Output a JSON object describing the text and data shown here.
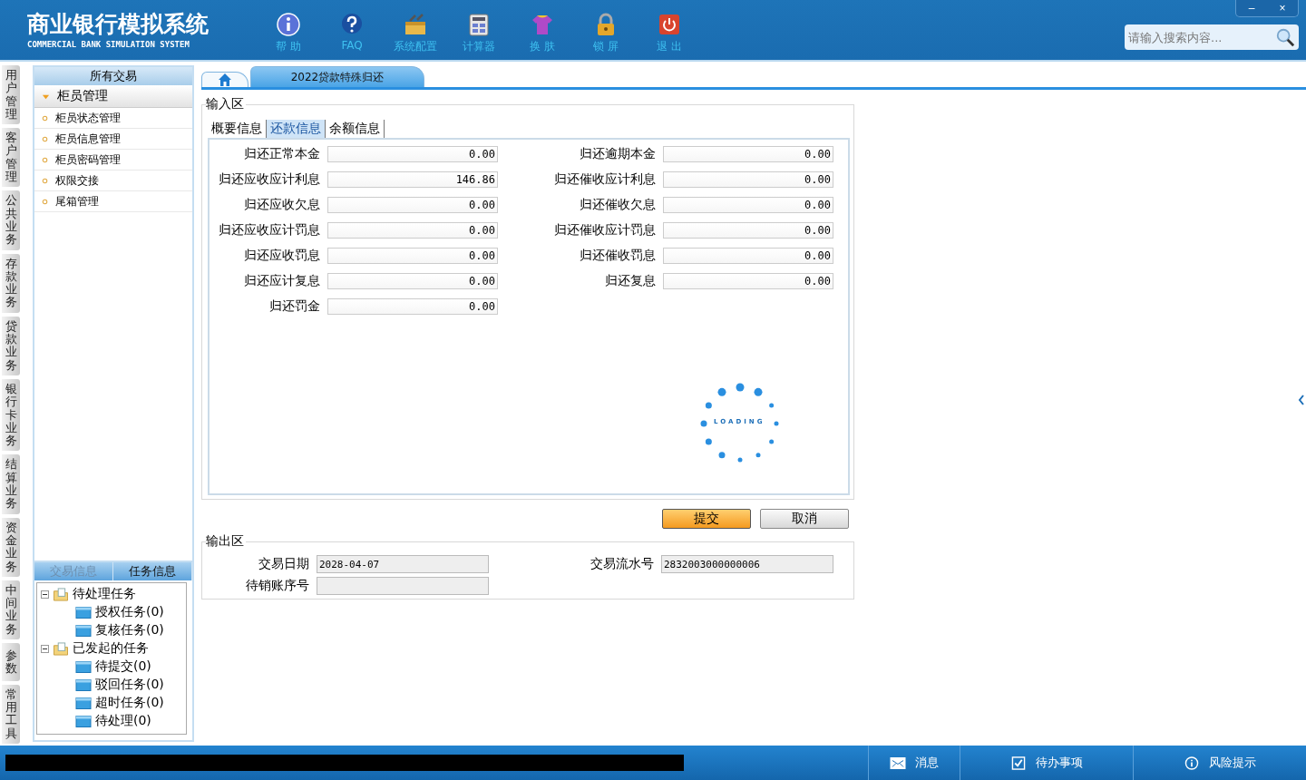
{
  "header": {
    "title": "商业银行模拟系统",
    "subtitle": "COMMERCIAL BANK SIMULATION SYSTEM",
    "tools": [
      {
        "kind": "info",
        "label": "帮 助"
      },
      {
        "kind": "faq",
        "label": "FAQ"
      },
      {
        "kind": "toolbox",
        "label": "系统配置"
      },
      {
        "kind": "calc",
        "label": "计算器"
      },
      {
        "kind": "shirt",
        "label": "换 肤"
      },
      {
        "kind": "lock",
        "label": "锁 屏"
      },
      {
        "kind": "power",
        "label": "退 出"
      }
    ],
    "window_buttons": [
      "–",
      "×"
    ],
    "search": {
      "placeholder": "请输入搜索内容..."
    }
  },
  "side_tabs": [
    "用户管理",
    "客户管理",
    "公共业务",
    "存款业务",
    "贷款业务",
    "银行卡业务",
    "结算业务",
    "资金业务",
    "中间业务",
    "参数",
    "常用工具"
  ],
  "sidebar": {
    "title": "所有交易",
    "group": {
      "label": "柜员管理",
      "expanded": true
    },
    "items": [
      "柜员状态管理",
      "柜员信息管理",
      "柜员密码管理",
      "权限交接",
      "尾箱管理"
    ]
  },
  "task_panel": {
    "tabs": [
      {
        "label": "交易信息",
        "selected": false
      },
      {
        "label": "任务信息",
        "selected": true
      }
    ],
    "tree": [
      {
        "label": "待处理任务",
        "expanded": true,
        "children": [
          {
            "label": "授权任务(0)"
          },
          {
            "label": "复核任务(0)"
          }
        ]
      },
      {
        "label": "已发起的任务",
        "expanded": true,
        "children": [
          {
            "label": "待提交(0)"
          },
          {
            "label": "驳回任务(0)"
          },
          {
            "label": "超时任务(0)"
          },
          {
            "label": "待处理(0)"
          }
        ]
      }
    ]
  },
  "page_tabs": [
    {
      "kind": "home",
      "selected": false
    },
    {
      "kind": "text",
      "label": "2022贷款特殊归还",
      "selected": true
    }
  ],
  "input_area": {
    "title": "输入区",
    "tabs": [
      {
        "label": "概要信息",
        "selected": false
      },
      {
        "label": "还款信息",
        "selected": true
      },
      {
        "label": "余额信息",
        "selected": false
      }
    ],
    "left_fields": [
      {
        "label": "归还正常本金",
        "value": "0.00"
      },
      {
        "label": "归还应收应计利息",
        "value": "146.86"
      },
      {
        "label": "归还应收欠息",
        "value": "0.00"
      },
      {
        "label": "归还应收应计罚息",
        "value": "0.00"
      },
      {
        "label": "归还应收罚息",
        "value": "0.00"
      },
      {
        "label": "归还应计复息",
        "value": "0.00"
      },
      {
        "label": "归还罚金",
        "value": "0.00"
      }
    ],
    "right_fields": [
      {
        "label": "归还逾期本金",
        "value": "0.00"
      },
      {
        "label": "归还催收应计利息",
        "value": "0.00"
      },
      {
        "label": "归还催收欠息",
        "value": "0.00"
      },
      {
        "label": "归还催收应计罚息",
        "value": "0.00"
      },
      {
        "label": "归还催收罚息",
        "value": "0.00"
      },
      {
        "label": "归还复息",
        "value": "0.00"
      }
    ],
    "loading": "LOADING"
  },
  "buttons": [
    {
      "kind": "primary",
      "label": "提交"
    },
    {
      "kind": "normal",
      "label": "取消"
    }
  ],
  "output_area": {
    "title": "输出区",
    "fields": [
      {
        "label": "交易日期",
        "value": "2028-04-07"
      },
      {
        "label": "交易流水号",
        "value": "2832003000000006"
      },
      {
        "label": "待销账序号"
      }
    ]
  },
  "status_bar": {
    "items": [
      {
        "kind": "mail",
        "label": "消息"
      },
      {
        "kind": "check",
        "label": "待办事项"
      },
      {
        "kind": "info",
        "label": "风险提示"
      }
    ]
  }
}
